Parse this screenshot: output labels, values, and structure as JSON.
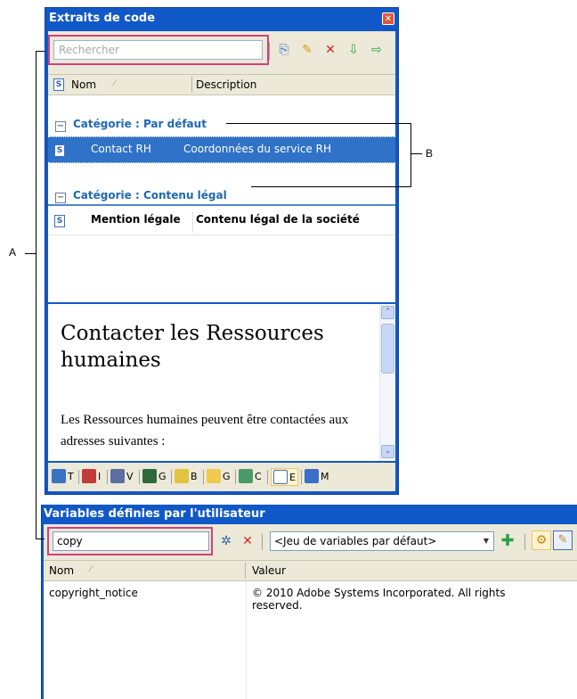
{
  "snippets_panel": {
    "title": "Extraits de code",
    "search_placeholder": "Rechercher",
    "columns": [
      "Nom",
      "Description"
    ],
    "categories": [
      {
        "label": "Catégorie : Par défaut",
        "items": [
          {
            "name": "Contact RH",
            "description": "Coordonnées du service RH"
          }
        ]
      },
      {
        "label": "Catégorie : Contenu légal",
        "items": [
          {
            "name": "Mention légale",
            "description": "Contenu légal de la société"
          }
        ]
      }
    ],
    "preview": {
      "heading": "Contacter les Ressources humaines",
      "body": "Les Ressources humaines peuvent être contactées aux adresses suivantes :"
    },
    "tabs": [
      {
        "letter": "T",
        "icon": "table-icon"
      },
      {
        "letter": "I",
        "icon": "list-icon"
      },
      {
        "letter": "V",
        "icon": "binoculars-icon"
      },
      {
        "letter": "G",
        "icon": "book-icon"
      },
      {
        "letter": "B",
        "icon": "pencil-icon"
      },
      {
        "letter": "G",
        "icon": "folder-icon"
      },
      {
        "letter": "C",
        "icon": "plug-icon"
      },
      {
        "letter": "E",
        "icon": "snippet-icon",
        "active": true
      },
      {
        "letter": "M",
        "icon": "link-icon"
      }
    ]
  },
  "variables_panel": {
    "title": "Variables définies par l'utilisateur",
    "search_value": "copy",
    "variable_set": "<Jeu de variables par défaut>",
    "columns": [
      "Nom",
      "Valeur"
    ],
    "rows": [
      {
        "name": "copyright_notice",
        "value": "© 2010 Adobe Systems Incorporated. All rights reserved."
      }
    ]
  },
  "callouts": {
    "a": "A",
    "b": "B"
  },
  "colors": {
    "panel_blue": "#1058c8",
    "highlight_pink": "#d3407f",
    "category_blue": "#1e68b4",
    "selection": "#2f72c7"
  }
}
